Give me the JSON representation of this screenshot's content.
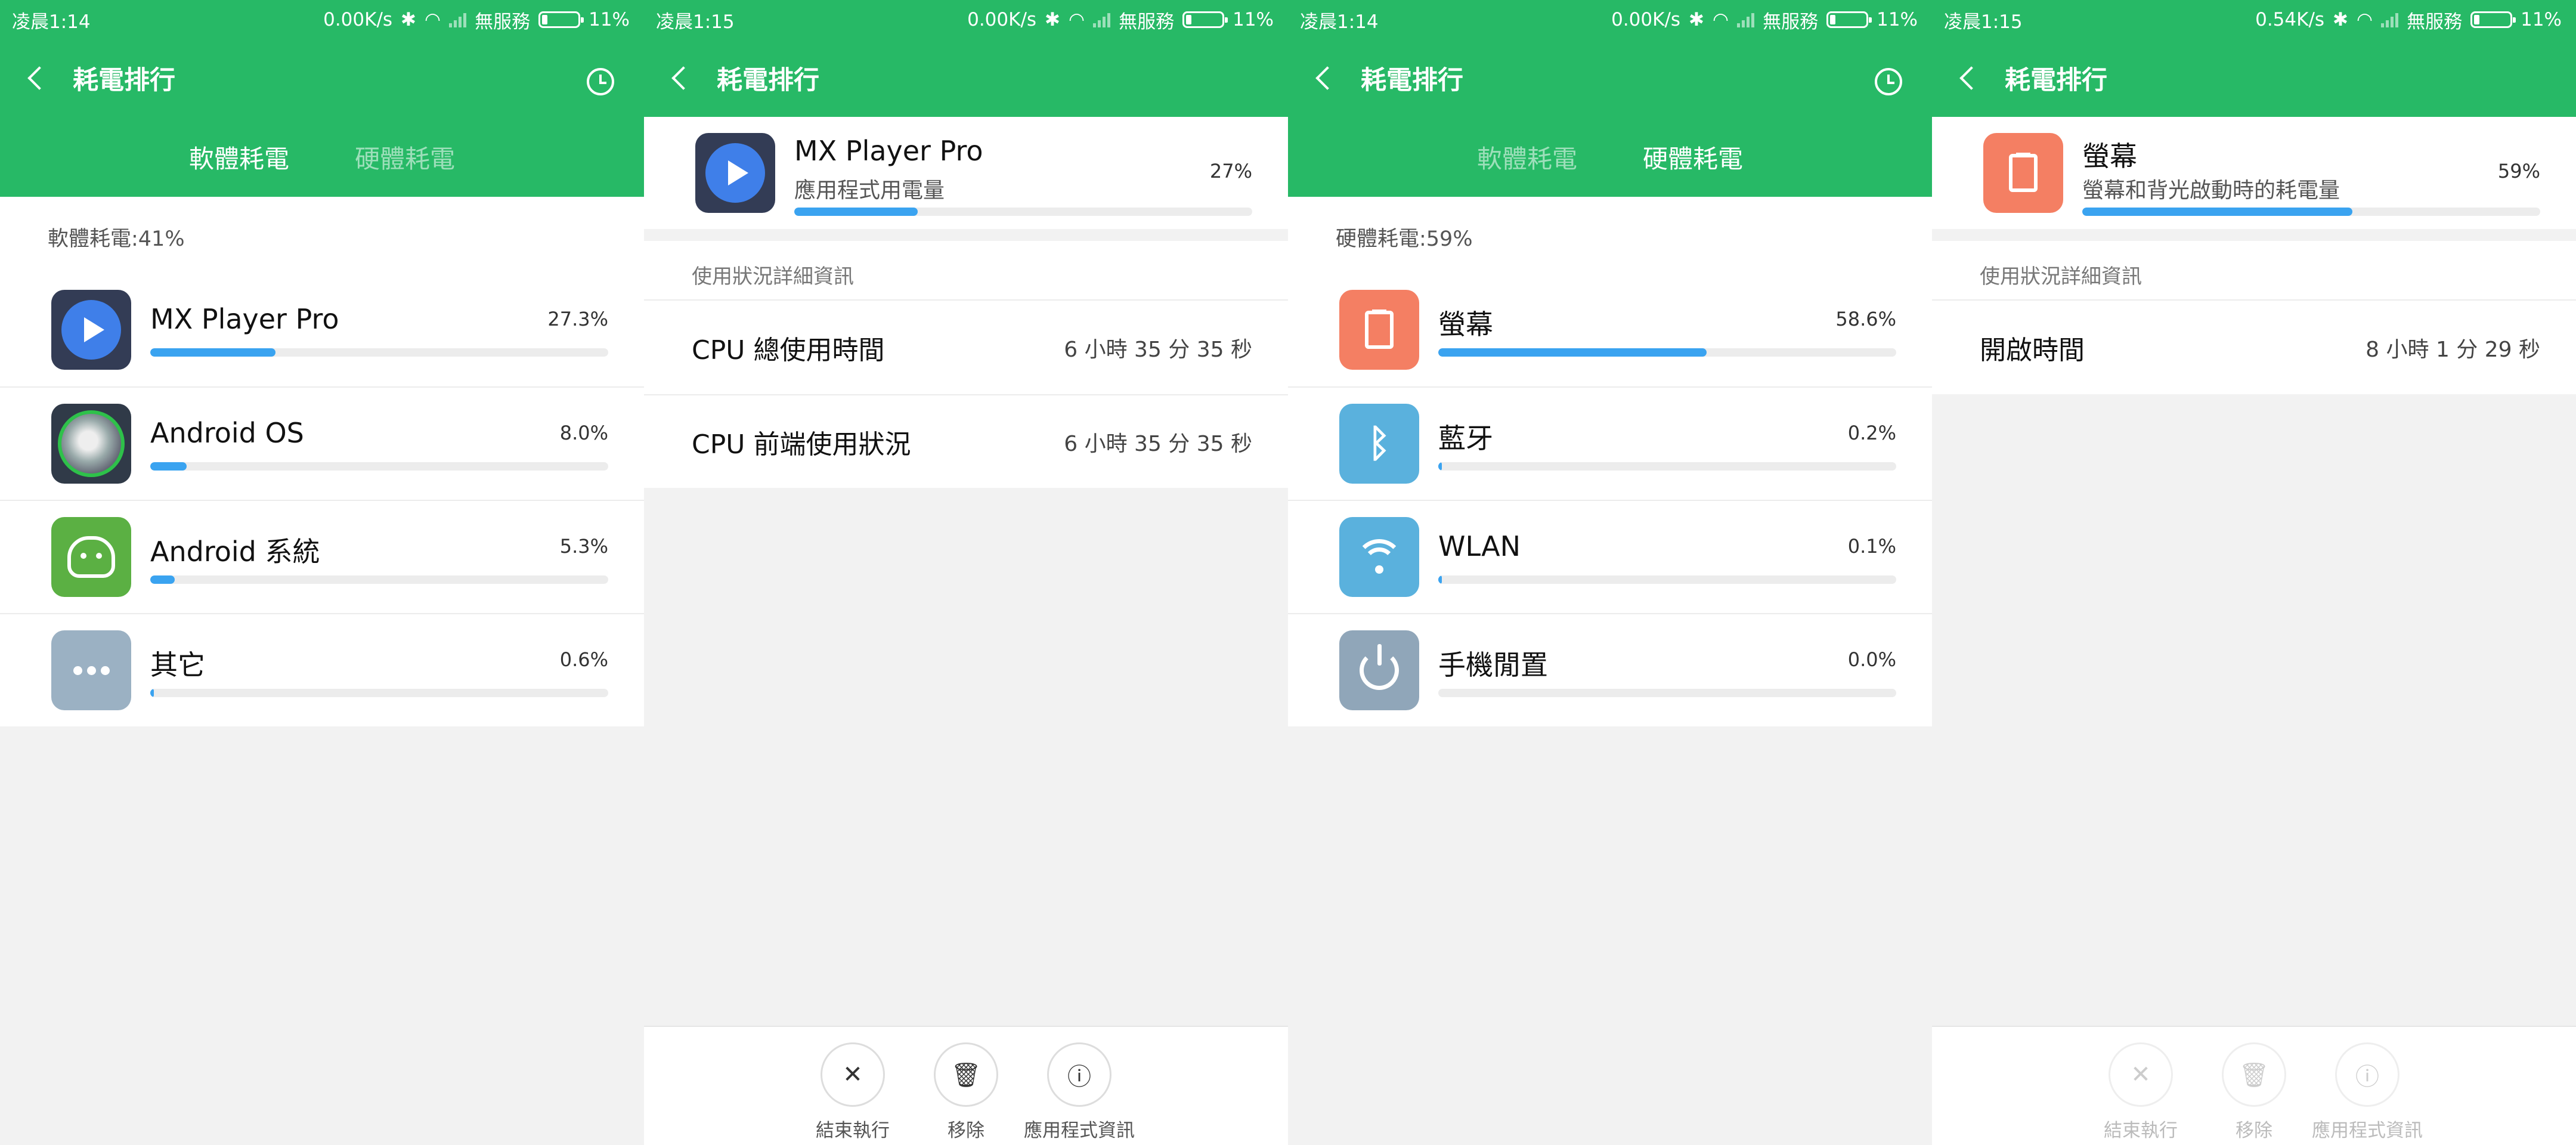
{
  "screens": [
    {
      "status": {
        "time": "凌晨1:14",
        "speed": "0.00K/s",
        "carrier": "無服務",
        "battery": "11%"
      },
      "title": "耗電排行",
      "tabs": [
        "軟體耗電",
        "硬體耗電"
      ],
      "active_tab": 0,
      "summary": "軟體耗電:41%",
      "items": [
        {
          "name": "MX Player Pro",
          "percent": "27.3%",
          "fill": 0.273,
          "icon": "mx-player-icon"
        },
        {
          "name": "Android OS",
          "percent": "8.0%",
          "fill": 0.08,
          "icon": "android-os-icon"
        },
        {
          "name": "Android 系統",
          "percent": "5.3%",
          "fill": 0.053,
          "icon": "android-system-icon"
        },
        {
          "name": "其它",
          "percent": "0.6%",
          "fill": 0.006,
          "icon": "more-icon"
        }
      ]
    },
    {
      "status": {
        "time": "凌晨1:15",
        "speed": "0.00K/s",
        "carrier": "無服務",
        "battery": "11%"
      },
      "title": "耗電排行",
      "app": {
        "name": "MX Player Pro",
        "subtitle": "應用程式用電量",
        "percent": "27%",
        "fill": 0.27,
        "icon": "mx-player-icon"
      },
      "section_label": "使用狀況詳細資訊",
      "details": [
        {
          "label": "CPU 總使用時間",
          "value": "6 小時 35 分 35 秒"
        },
        {
          "label": "CPU 前端使用狀況",
          "value": "6 小時 35 分 35 秒"
        }
      ],
      "actions": [
        {
          "label": "結束執行",
          "icon": "close-icon",
          "glyph": "✕"
        },
        {
          "label": "移除",
          "icon": "trash-icon",
          "glyph": "🗑"
        },
        {
          "label": "應用程式資訊",
          "icon": "info-icon",
          "glyph": "ⓘ"
        }
      ]
    },
    {
      "status": {
        "time": "凌晨1:14",
        "speed": "0.00K/s",
        "carrier": "無服務",
        "battery": "11%"
      },
      "title": "耗電排行",
      "tabs": [
        "軟體耗電",
        "硬體耗電"
      ],
      "active_tab": 1,
      "summary": "硬體耗電:59%",
      "items": [
        {
          "name": "螢幕",
          "percent": "58.6%",
          "fill": 0.586,
          "icon": "screen-icon"
        },
        {
          "name": "藍牙",
          "percent": "0.2%",
          "fill": 0.002,
          "icon": "bluetooth-icon"
        },
        {
          "name": "WLAN",
          "percent": "0.1%",
          "fill": 0.001,
          "icon": "wifi-icon"
        },
        {
          "name": "手機閒置",
          "percent": "0.0%",
          "fill": 0.0,
          "icon": "power-icon"
        }
      ]
    },
    {
      "status": {
        "time": "凌晨1:15",
        "speed": "0.54K/s",
        "carrier": "無服務",
        "battery": "11%"
      },
      "title": "耗電排行",
      "app": {
        "name": "螢幕",
        "subtitle": "螢幕和背光啟動時的耗電量",
        "percent": "59%",
        "fill": 0.59,
        "icon": "screen-icon"
      },
      "section_label": "使用狀況詳細資訊",
      "details": [
        {
          "label": "開啟時間",
          "value": "8 小時 1 分 29 秒"
        }
      ],
      "actions": [
        {
          "label": "結束執行",
          "icon": "close-icon",
          "glyph": "✕"
        },
        {
          "label": "移除",
          "icon": "trash-icon",
          "glyph": "🗑"
        },
        {
          "label": "應用程式資訊",
          "icon": "info-icon",
          "glyph": "ⓘ"
        }
      ],
      "actions_disabled": true
    }
  ],
  "colors": {
    "header": "#27b966",
    "bar": "#3aa3f0"
  }
}
